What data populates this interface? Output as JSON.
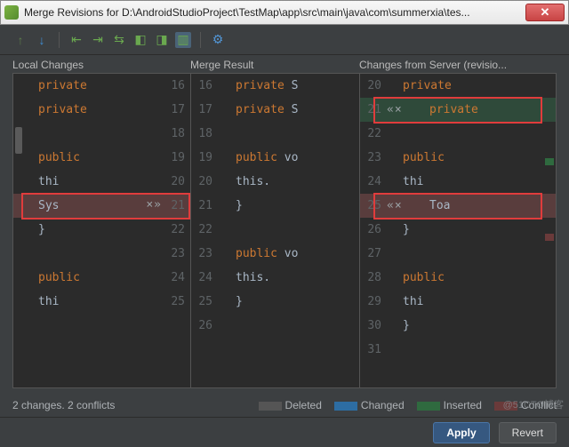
{
  "window": {
    "title": "Merge Revisions for D:\\AndroidStudioProject\\TestMap\\app\\src\\main\\java\\com\\summerxia\\tes..."
  },
  "headers": {
    "local": "Local Changes",
    "merge": "Merge Result",
    "server": "Changes from Server (revisio..."
  },
  "legend": {
    "status": "2 changes. 2 conflicts",
    "deleted": "Deleted",
    "changed": "Changed",
    "inserted": "Inserted",
    "conflict": "Conflict"
  },
  "buttons": {
    "apply": "Apply",
    "revert": "Revert"
  },
  "colors": {
    "deleted": "#555555",
    "changed": "#2d6da3",
    "inserted": "#2f6a3f",
    "conflict": "#6a3a3a",
    "highlight_box": "#e03c3c",
    "merge_outline": "#3fa648"
  },
  "local": [
    {
      "n": 16,
      "kw": "private",
      "code": ""
    },
    {
      "n": 17,
      "kw": "private",
      "code": ""
    },
    {
      "n": 18,
      "kw": "",
      "code": ""
    },
    {
      "n": 19,
      "kw": "public",
      "code": ""
    },
    {
      "n": 20,
      "kw": "",
      "code": "thi"
    },
    {
      "n": 21,
      "kw": "",
      "code": "Sys",
      "ctrl": "×»",
      "state": "conflict"
    },
    {
      "n": 22,
      "kw": "",
      "code": "}"
    },
    {
      "n": 23,
      "kw": "",
      "code": ""
    },
    {
      "n": 24,
      "kw": "public",
      "code": ""
    },
    {
      "n": 25,
      "kw": "",
      "code": "thi"
    }
  ],
  "merge": [
    {
      "n": 16,
      "kw": "private",
      "code": " S"
    },
    {
      "n": 17,
      "kw": "private",
      "code": " S"
    },
    {
      "n": 18,
      "kw": "",
      "code": ""
    },
    {
      "n": 19,
      "kw": "public",
      "code": " vo"
    },
    {
      "n": 20,
      "kw": "",
      "code": "this."
    },
    {
      "n": 21,
      "kw": "",
      "code": "}"
    },
    {
      "n": 22,
      "kw": "",
      "code": ""
    },
    {
      "n": 23,
      "kw": "public",
      "code": " vo"
    },
    {
      "n": 24,
      "kw": "",
      "code": "this."
    },
    {
      "n": 25,
      "kw": "",
      "code": "}"
    },
    {
      "n": 26,
      "kw": "",
      "code": ""
    }
  ],
  "server": [
    {
      "n": 20,
      "kw": "private",
      "code": ""
    },
    {
      "n": 21,
      "kw": "private",
      "code": "",
      "ctrl": "«×",
      "state": "inserted"
    },
    {
      "n": 22,
      "kw": "",
      "code": ""
    },
    {
      "n": 23,
      "kw": "public",
      "code": ""
    },
    {
      "n": 24,
      "kw": "",
      "code": "thi"
    },
    {
      "n": 25,
      "kw": "",
      "code": "Toa",
      "ctrl": "«×",
      "state": "conflict"
    },
    {
      "n": 26,
      "kw": "",
      "code": "}"
    },
    {
      "n": 27,
      "kw": "",
      "code": ""
    },
    {
      "n": 28,
      "kw": "public",
      "code": ""
    },
    {
      "n": 29,
      "kw": "",
      "code": "thi"
    },
    {
      "n": 30,
      "kw": "",
      "code": "}"
    },
    {
      "n": 31,
      "kw": "",
      "code": ""
    }
  ],
  "watermark": "@51CTO博客"
}
